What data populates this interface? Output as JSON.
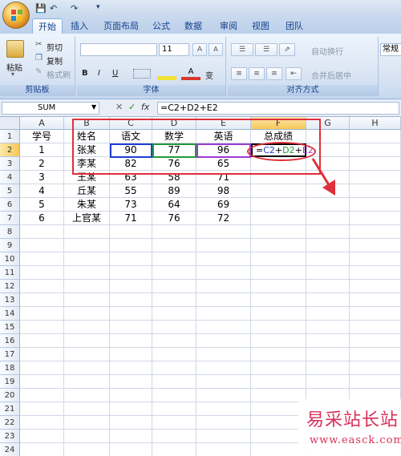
{
  "quick_access": {
    "save_icon": "save-icon",
    "undo_icon": "undo-icon",
    "redo_icon": "redo-icon"
  },
  "tabs": [
    "开始",
    "插入",
    "页面布局",
    "公式",
    "数据",
    "审阅",
    "视图",
    "团队"
  ],
  "ribbon": {
    "clipboard": {
      "paste": "粘贴",
      "cut": "剪切",
      "copy": "复制",
      "format_painter": "格式刷",
      "label": "剪贴板"
    },
    "font": {
      "size": "11",
      "bold": "B",
      "italic": "I",
      "underline": "U",
      "grow": "A",
      "shrink": "A",
      "phonetic": "变",
      "label": "字体"
    },
    "alignment": {
      "wrap": "自动换行",
      "merge": "合并后居中",
      "label": "对齐方式"
    },
    "number": {
      "format": "常规"
    }
  },
  "formula_bar": {
    "name_box": "SUM",
    "cancel": "✕",
    "enter": "✓",
    "fx": "fx",
    "formula": "=C2+D2+E2"
  },
  "columns": [
    "A",
    "B",
    "C",
    "D",
    "E",
    "F",
    "G",
    "H"
  ],
  "rows": [
    "1",
    "2",
    "3",
    "4",
    "5",
    "6",
    "7",
    "8",
    "9",
    "10",
    "11",
    "12",
    "13",
    "14",
    "15",
    "16",
    "17",
    "18",
    "19",
    "20",
    "21",
    "22",
    "23",
    "24"
  ],
  "table": [
    [
      "学号",
      "姓名",
      "语文",
      "数学",
      "英语",
      "总成绩"
    ],
    [
      "1",
      "张某",
      "90",
      "77",
      "96",
      "=C2+D2+E2"
    ],
    [
      "2",
      "李某",
      "82",
      "76",
      "65",
      ""
    ],
    [
      "3",
      "王某",
      "63",
      "58",
      "71",
      ""
    ],
    [
      "4",
      "丘某",
      "55",
      "89",
      "98",
      ""
    ],
    [
      "5",
      "朱某",
      "73",
      "64",
      "69",
      ""
    ],
    [
      "6",
      "上官某",
      "71",
      "76",
      "72",
      ""
    ]
  ],
  "formula_parts": [
    {
      "text": "=",
      "color": "#000000"
    },
    {
      "text": "C2",
      "color": "#1f3fd1"
    },
    {
      "text": "+",
      "color": "#000000"
    },
    {
      "text": "D2",
      "color": "#1f9b3a"
    },
    {
      "text": "+",
      "color": "#000000"
    },
    {
      "text": "E2",
      "color": "#9b3bd1"
    }
  ],
  "watermark": {
    "title": "易采站长站",
    "url": "www.easck.com"
  },
  "colors": {
    "annotation_red": "#e0303a",
    "ref_blue": "#1f3fd1",
    "ref_green": "#1f9b3a",
    "ref_purple": "#9b3bd1"
  }
}
